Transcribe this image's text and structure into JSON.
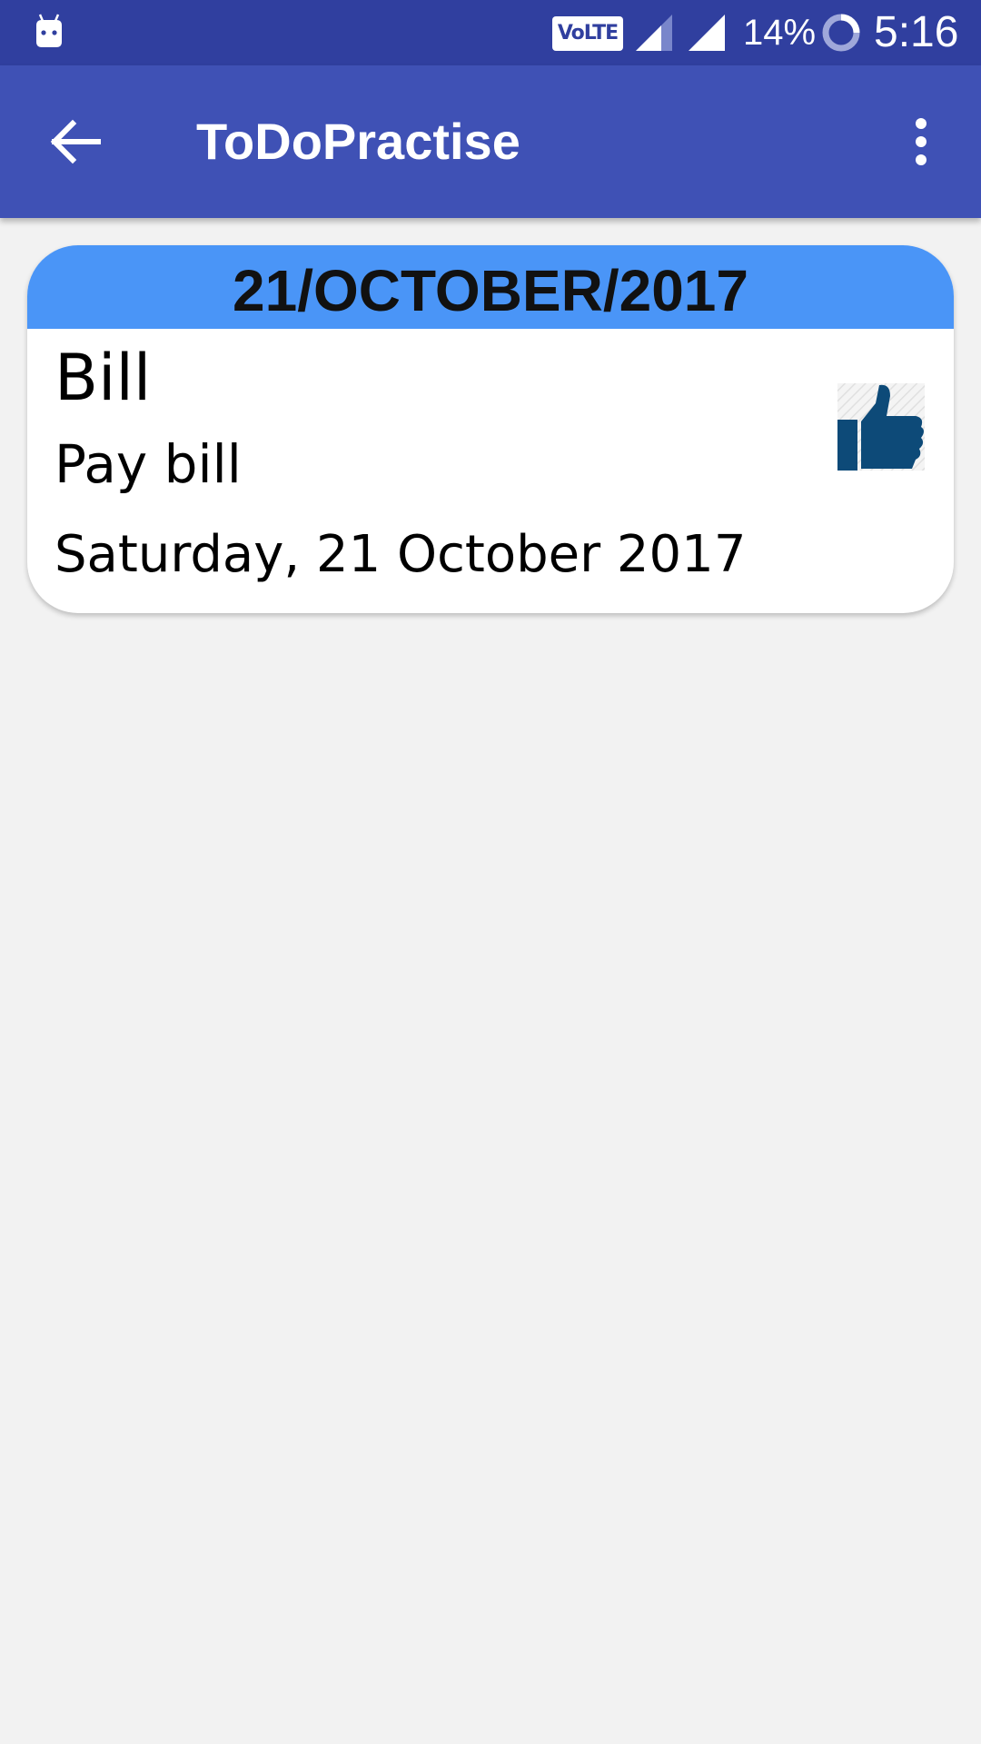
{
  "status_bar": {
    "network_badge": "VoLTE",
    "battery": "14%",
    "time": "5:16"
  },
  "app_bar": {
    "title": "ToDoPractise"
  },
  "todo_card": {
    "header_date": "21/OCTOBER/2017",
    "title": "Bill",
    "description": "Pay bill",
    "date": "Saturday, 21 October 2017",
    "icon": "thumbs-up-icon"
  },
  "colors": {
    "status_bar": "#303f9f",
    "app_bar": "#3f51b5",
    "card_header": "#4a95f7",
    "thumb_icon": "#0d4a78",
    "background": "#f2f2f2"
  }
}
